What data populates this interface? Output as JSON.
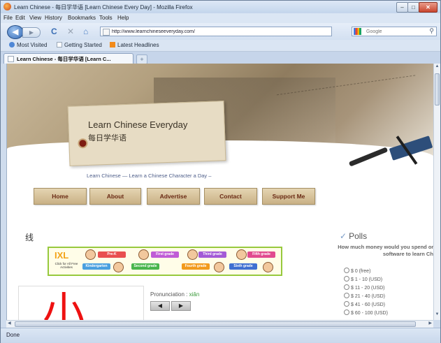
{
  "window": {
    "title": "Learn Chinese - 每日学华语 [Learn Chinese Every Day] - Mozilla Firefox",
    "controls": {
      "minimize": "–",
      "maximize": "□",
      "close": "✕"
    }
  },
  "menubar": {
    "items": [
      "File",
      "Edit",
      "View",
      "History",
      "Bookmarks",
      "Tools",
      "Help"
    ]
  },
  "navbar": {
    "url": "http://www.learnchineseeveryday.com/",
    "search_placeholder": "Google"
  },
  "bookmarks": {
    "items": [
      "Most Visited",
      "Getting Started",
      "Latest Headlines"
    ]
  },
  "tabs": [
    {
      "label": "Learn Chinese - 每日学华语 [Learn C..."
    }
  ],
  "statusbar": {
    "text": "Done"
  },
  "page": {
    "site_title": "Learn Chinese Everyday",
    "site_title_cn": "每日学华语",
    "tagline": "Learn Chinese — Learn a Chinese Character a Day –",
    "nav": [
      "Home",
      "About",
      "Advertise",
      "Contact",
      "Support Me"
    ],
    "character_small": "线",
    "character_big": "小",
    "ad": {
      "brand": "IXL",
      "subtitle": "Click for All Free Activities",
      "grades": [
        "Pre-K",
        "Kindergarten",
        "First grade",
        "Second grade",
        "Third grade",
        "Fourth grade",
        "Fifth grade",
        "Sixth grade"
      ]
    },
    "pronunciation": {
      "label": "Pronunciation",
      "value": "xiǎn"
    },
    "controls": {
      "prev": "◀",
      "next": "▶"
    },
    "polls": {
      "title": "Polls",
      "question": "How much money would you spend on software to learn Chi",
      "options": [
        "$ 0 (free)",
        "$ 1 - 10 (USD)",
        "$ 11 - 20 (USD)",
        "$ 21 - 40 (USD)",
        "$ 41 - 60 (USD)",
        "$ 60 - 100 (USD)"
      ]
    }
  },
  "colors": {
    "nav_text": "#6a2a14",
    "character": "#e11111",
    "pinyin": "#3a9a3a",
    "ad_border": "#97c93d"
  }
}
